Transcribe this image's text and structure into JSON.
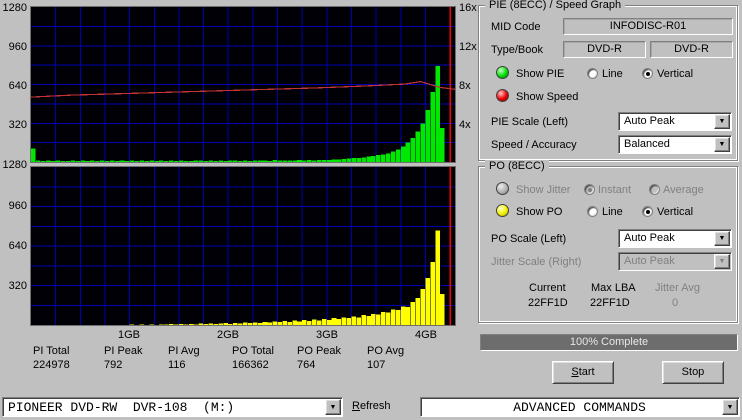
{
  "ui": {
    "bg_color": "#c0c0c0"
  },
  "chart_data": {
    "type": "bar",
    "title": "PIE (8ECC) / Speed Graph",
    "po_title": "PO (8ECC)",
    "x_axis": {
      "unit": "GB",
      "range": [
        0,
        4.3
      ],
      "ticks": [
        "1GB",
        "2GB",
        "3GB",
        "4GB"
      ]
    },
    "left_axis": {
      "max": 1280,
      "ticks": [
        "1280",
        "960",
        "640",
        "320"
      ]
    },
    "speed_axis": {
      "max_x": 16,
      "ticks": [
        "16x",
        "12x",
        "8x",
        "4x"
      ]
    },
    "colors": {
      "pie": "#00e800",
      "po": "#ffff00",
      "speed_line": "#c23434",
      "grid": "#0000b2",
      "plot_bg": "#000006",
      "end_marker": "#ff0000"
    },
    "end_marker_gb": 4.25,
    "bin_width_gb": 0.05,
    "pie_bins": [
      110,
      14,
      10,
      12,
      9,
      13,
      10,
      8,
      12,
      10,
      11,
      9,
      13,
      10,
      12,
      8,
      11,
      9,
      12,
      10,
      13,
      9,
      11,
      10,
      12,
      9,
      13,
      10,
      11,
      8,
      12,
      10,
      9,
      13,
      11,
      10,
      12,
      9,
      14,
      10,
      12,
      11,
      9,
      13,
      10,
      14,
      11,
      12,
      10,
      15,
      12,
      11,
      14,
      12,
      15,
      13,
      16,
      14,
      17,
      15,
      18,
      20,
      22,
      25,
      28,
      31,
      35,
      39,
      44,
      50,
      56,
      62,
      70,
      85,
      105,
      130,
      160,
      200,
      250,
      320,
      430,
      580,
      792,
      280,
      0,
      0
    ],
    "po_bins": [
      0,
      0,
      0,
      0,
      0,
      0,
      0,
      0,
      0,
      0,
      0,
      0,
      0,
      0,
      0,
      0,
      0,
      0,
      2,
      0,
      3,
      0,
      4,
      2,
      5,
      0,
      6,
      3,
      7,
      4,
      8,
      5,
      10,
      6,
      12,
      8,
      14,
      10,
      12,
      16,
      10,
      18,
      14,
      20,
      16,
      22,
      18,
      25,
      20,
      28,
      24,
      32,
      26,
      36,
      30,
      40,
      34,
      45,
      38,
      50,
      42,
      55,
      48,
      62,
      55,
      70,
      62,
      80,
      72,
      90,
      85,
      105,
      100,
      125,
      120,
      150,
      145,
      185,
      220,
      290,
      380,
      510,
      764,
      250,
      0,
      0
    ],
    "speed_points": [
      [
        0,
        6.7
      ],
      [
        0.4,
        6.9
      ],
      [
        0.9,
        7.05
      ],
      [
        1.4,
        7.2
      ],
      [
        1.9,
        7.35
      ],
      [
        2.4,
        7.5
      ],
      [
        2.9,
        7.65
      ],
      [
        3.4,
        7.85
      ],
      [
        3.8,
        8.05
      ],
      [
        3.95,
        8.3
      ],
      [
        4.05,
        8.0
      ],
      [
        4.15,
        7.7
      ],
      [
        4.3,
        7.5
      ]
    ]
  },
  "stats": [
    {
      "label": "PI Total",
      "value": "224978"
    },
    {
      "label": "PI Peak",
      "value": "792"
    },
    {
      "label": "PI Avg",
      "value": "116"
    },
    {
      "label": "PO Total",
      "value": "166362"
    },
    {
      "label": "PO Peak",
      "value": "764"
    },
    {
      "label": "PO Avg",
      "value": "107"
    }
  ],
  "pie_panel": {
    "title": "PIE (8ECC) / Speed Graph",
    "mid_code_label": "MID Code",
    "mid_code_value": "INFODISC-R01",
    "type_book_label": "Type/Book",
    "type_book_value_1": "DVD-R",
    "type_book_value_2": "DVD-R",
    "show_pie_label": "Show PIE",
    "show_speed_label": "Show Speed",
    "line_label": "Line",
    "vertical_label": "Vertical",
    "pie_scale_label": "PIE Scale (Left)",
    "pie_scale_value": "Auto Peak",
    "speed_accuracy_label": "Speed / Accuracy",
    "speed_accuracy_value": "Balanced"
  },
  "po_panel": {
    "title": "PO (8ECC)",
    "show_jitter_label": "Show Jitter",
    "instant_label": "Instant",
    "average_label": "Average",
    "show_po_label": "Show PO",
    "line_label": "Line",
    "vertical_label": "Vertical",
    "po_scale_label": "PO Scale (Left)",
    "po_scale_value": "Auto Peak",
    "jitter_scale_label": "Jitter Scale (Right)",
    "jitter_scale_value": "Auto Peak",
    "current_label": "Current",
    "max_lba_label": "Max LBA",
    "jitter_avg_label": "Jitter Avg",
    "current_value": "22FF1D",
    "max_lba_value": "22FF1D",
    "jitter_avg_value": "0"
  },
  "progress": {
    "text": "100% Complete",
    "percent": 100
  },
  "buttons": {
    "start_initial": "S",
    "start_rest": "tart",
    "stop": "Stop"
  },
  "bottom_bar": {
    "drive": "PIONEER DVD-RW  DVR-108  (M:)",
    "refresh_initial": "R",
    "refresh_rest": "efresh",
    "commands": "ADVANCED COMMANDS"
  }
}
